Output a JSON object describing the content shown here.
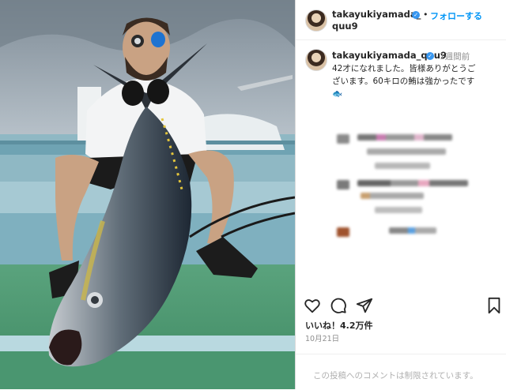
{
  "post": {
    "username": "takayukiyamada_",
    "username_line2": "quu9",
    "follow_separator": "•",
    "follow_label": "フォローする",
    "caption_username": "takayukiyamada_quu9",
    "timestamp": "1週間前",
    "caption_line1": "42才になれました。皆様ありがとうご",
    "caption_line2": "ざいます。60キロの鮪は強かったです",
    "caption_emoji": "🐟",
    "likes_text": "いいね！4.2万件",
    "date_text": "10月21日",
    "comments_restricted": "この投稿へのコメントは制限されています。",
    "verified_mark": "✓"
  },
  "icons": {
    "heart": "heart-icon",
    "comment": "comment-icon",
    "share": "share-icon",
    "bookmark": "bookmark-icon"
  },
  "colors": {
    "link_blue": "#0095f6",
    "verified_blue": "#3897f0",
    "muted_gray": "#8e8e8e"
  }
}
